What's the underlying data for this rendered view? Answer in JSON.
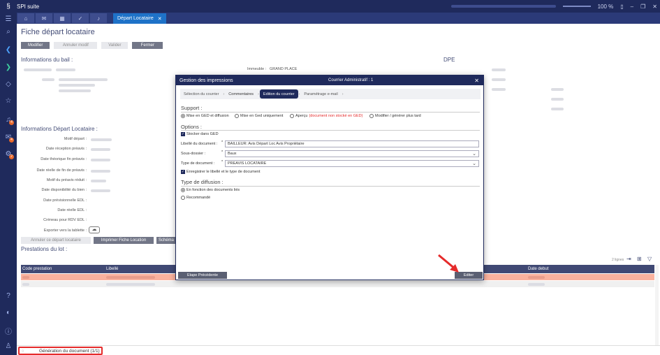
{
  "app": {
    "title": "SPI suite",
    "zoom": "100 %"
  },
  "tabs": {
    "active": "Départ Locataire"
  },
  "page": {
    "title": "Fiche départ locataire",
    "buttons": {
      "modifier": "Modifier",
      "annuler": "Annuler modif",
      "valider": "Valider",
      "fermer": "Fermer"
    },
    "bail_title": "Informations du bail :",
    "immeuble_label": "Immeuble :",
    "immeuble_value": "GRAND PLACE",
    "dpe": "DPE",
    "depart_title": "Informations Départ Locataire :",
    "fields": [
      "Motif départ :",
      "Date réception préavis :",
      "Date théorique fin préavis :",
      "Date réelle de fin de préavis :",
      "Motif du préavis réduit :",
      "Date disponibilité du bien :",
      "Date prévisionnelle EDL :",
      "Date réelle EDL :",
      "Créneau pour RDV EDL :",
      "Exporter vers la tablette :"
    ],
    "actions": {
      "annuler_depart": "Annuler ce départ locataire",
      "imprimer": "Imprimer Fiche Location",
      "schema": "Schéma"
    },
    "prestations_title": "Prestations du lot :",
    "table": {
      "col_code": "Code prestation",
      "col_libelle": "Libellé",
      "col_date": "Date debut",
      "count": "2 lignes"
    }
  },
  "status": {
    "generation": "Génération du document (1/1)"
  },
  "dialog": {
    "title": "Gestion des impressions",
    "subtitle": "Courrier Administratif : 1",
    "steps": [
      "Sélection du courrier",
      "Commentaires",
      "Edition du courrier",
      "Paramétrage e-mail"
    ],
    "support_title": "Support :",
    "support_options": [
      "Mise en GED et diffusion",
      "Mise en Ged uniquement",
      "Aperçu",
      "Modifier / générer plus tard"
    ],
    "apercu_note": "(document non stocké en GED)",
    "options_title": "Options :",
    "stocker": "Stocker dans GED",
    "libelle_label": "Libellé du document :",
    "libelle_value": "BAILLEUR: Avis Départ Loc Avis Propriétaire",
    "sousdossier_label": "Sous-dossier :",
    "sousdossier_value": "Baux",
    "type_label": "Type de document :",
    "type_value": "PREAVIS LOCATAIRE",
    "enregistrer": "Enregistrer le libellé et le type de document",
    "diffusion_title": "Type de diffusion :",
    "diffusion_options": [
      "En fonction des documents liés",
      "Recommandé"
    ],
    "btn_prev": "Etape Précédente",
    "btn_edit": "Editer"
  }
}
